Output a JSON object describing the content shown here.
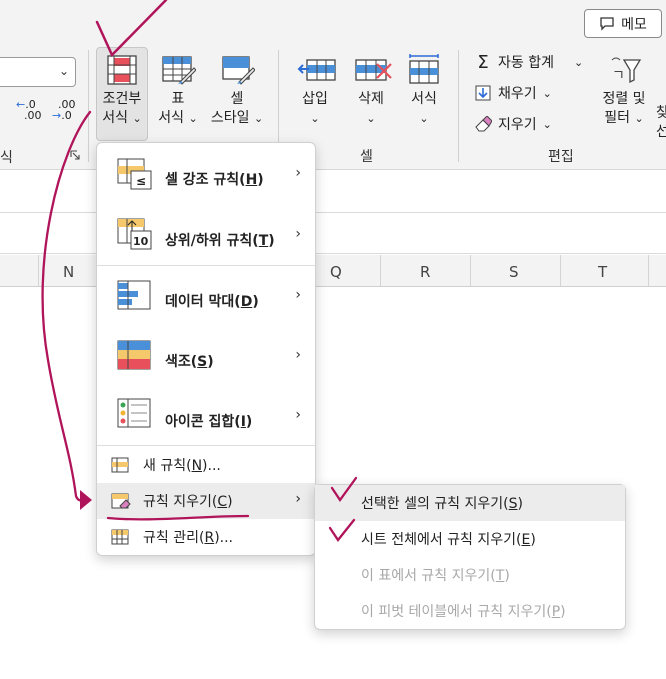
{
  "header": {
    "memo_label": "메모"
  },
  "ribbon": {
    "styles_group": {
      "conditional_formatting": {
        "line1": "조건부",
        "line2": "서식"
      },
      "format_as_table": {
        "line1": "표",
        "line2": "서식"
      },
      "cell_styles": {
        "line1": "셀",
        "line2": "스타일"
      }
    },
    "cells_group": {
      "label": "셀",
      "insert": "삽입",
      "delete": "삭제",
      "format": "서식"
    },
    "editing_group": {
      "label": "편집",
      "autosum": "자동 합계",
      "fill": "채우기",
      "clear": "지우기",
      "sort_filter": {
        "line1": "정렬 및",
        "line2": "필터"
      },
      "find_partial": {
        "line1": "찾",
        "line2": "선"
      }
    },
    "number_group_partial_label": "식",
    "decimal_increase": ".00",
    "decimal_decrease": ".0"
  },
  "columns": [
    "N",
    "Q",
    "R",
    "S",
    "T"
  ],
  "menu": {
    "items": [
      {
        "label": "셀 강조 규칙",
        "key": "H"
      },
      {
        "label": "상위/하위 규칙",
        "key": "T"
      },
      {
        "label": "데이터 막대",
        "key": "D"
      },
      {
        "label": "색조",
        "key": "S"
      },
      {
        "label": "아이콘 집합",
        "key": "I"
      }
    ],
    "new_rule": {
      "label": "새 규칙",
      "key": "N",
      "suffix": "..."
    },
    "clear_rules": {
      "label": "규칙 지우기",
      "key": "C"
    },
    "manage_rules": {
      "label": "규칙 관리",
      "key": "R",
      "suffix": "..."
    }
  },
  "submenu": {
    "items": [
      {
        "label": "선택한 셀의 규칙 지우기",
        "key": "S"
      },
      {
        "label": "시트 전체에서 규칙 지우기",
        "key": "E"
      },
      {
        "label": "이 표에서 규칙 지우기",
        "key": "T"
      },
      {
        "label": "이 피벗 테이블에서 규칙 지우기",
        "key": "P"
      }
    ]
  },
  "colors": {
    "annotation": "#b0145a",
    "accent_blue": "#2b6cd6",
    "highlight_red": "#e8505b",
    "menu_hover": "#ececec",
    "ribbon_bg": "#f3f3f3"
  }
}
